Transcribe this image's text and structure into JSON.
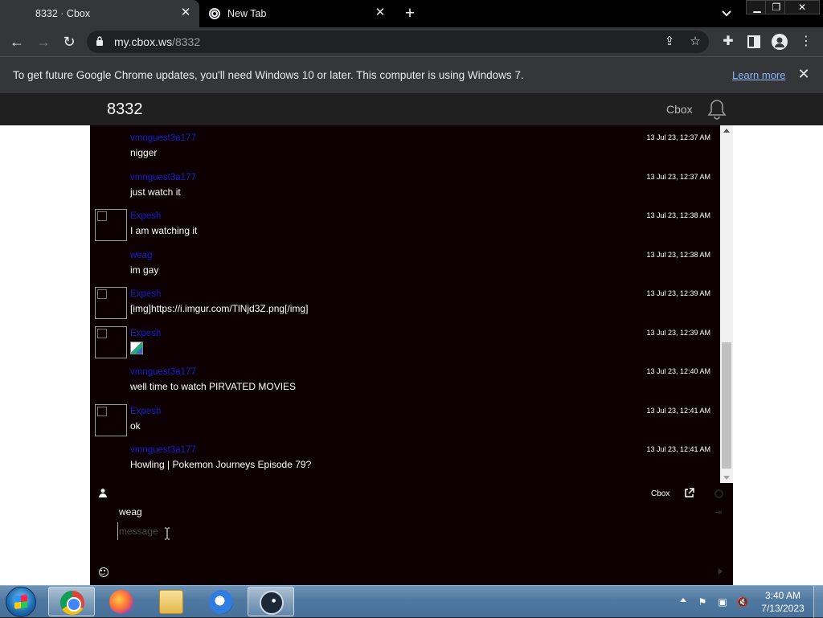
{
  "browser": {
    "tabs": [
      {
        "title": "8332 · Cbox",
        "active": true
      },
      {
        "title": "New Tab",
        "active": false
      }
    ],
    "url_host": "my.cbox.ws",
    "url_path": "/8332"
  },
  "infobar": {
    "message": "To get future Google Chrome updates, you'll need Windows 10 or later. This computer is using Windows 7.",
    "link": "Learn more"
  },
  "site": {
    "title": "8332",
    "cbox_label": "Cbox"
  },
  "chat": {
    "messages": [
      {
        "name": "vmnguest3a177",
        "body": "nigger",
        "time": "13 Jul 23, 12:37 AM",
        "has_avatar": false
      },
      {
        "name": "vmnguest3a177",
        "body": "just watch it",
        "time": "13 Jul 23, 12:37 AM",
        "has_avatar": false
      },
      {
        "name": "Expesh",
        "body": "I am watching it",
        "time": "13 Jul 23, 12:38 AM",
        "has_avatar": true
      },
      {
        "name": "weag",
        "body": "im gay",
        "time": "13 Jul 23, 12:38 AM",
        "has_avatar": false
      },
      {
        "name": "Expesh",
        "body": "[img]https://i.imgur.com/TlNjd3Z.png[/img]",
        "time": "13 Jul 23, 12:39 AM",
        "has_avatar": true
      },
      {
        "name": "Expesh",
        "body": "",
        "time": "13 Jul 23, 12:39 AM",
        "has_avatar": true,
        "image": true
      },
      {
        "name": "vmnguest3a177",
        "body": "well time to watch PIRVATED MOVIES",
        "time": "13 Jul 23, 12:40 AM",
        "has_avatar": false
      },
      {
        "name": "Expesh",
        "body": "ok",
        "time": "13 Jul 23, 12:41 AM",
        "has_avatar": true
      },
      {
        "name": "vmnguest3a177",
        "body": "Howling | Pokemon Journeys Episode 79?",
        "time": "13 Jul 23, 12:41 AM",
        "has_avatar": false
      }
    ],
    "footer": {
      "cbox_link": "Cbox",
      "username": "weag",
      "message_placeholder": "message"
    }
  },
  "taskbar": {
    "clock_time": "3:40 AM",
    "clock_date": "7/13/2023"
  },
  "colors": {
    "chat_background": "#0d0002",
    "name_color": "#1a1ad0",
    "link_color": "#8ab4f8"
  }
}
